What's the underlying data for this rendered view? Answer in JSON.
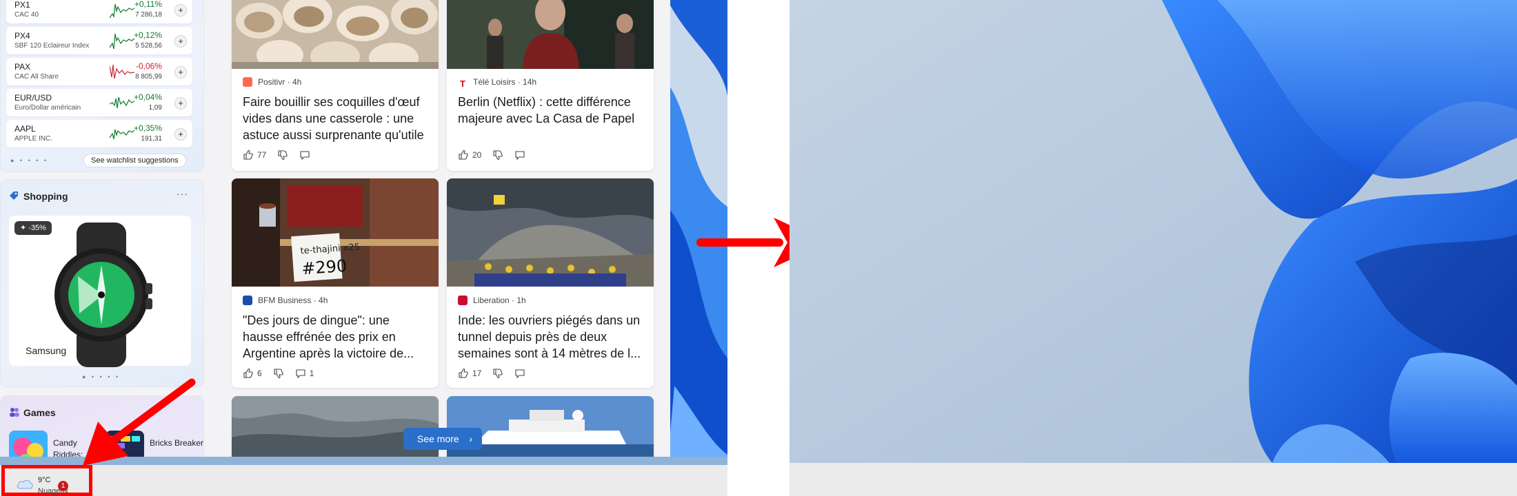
{
  "stocks": [
    {
      "symbol": "PX1",
      "name": "CAC 40",
      "change": "+0,11%",
      "price": "7 286,18",
      "direction": "up"
    },
    {
      "symbol": "PX4",
      "name": "SBF 120 Eclaireur Index",
      "change": "+0,12%",
      "price": "5 528,56",
      "direction": "up"
    },
    {
      "symbol": "PAX",
      "name": "CAC All Share",
      "change": "-0,06%",
      "price": "8 805,99",
      "direction": "down"
    },
    {
      "symbol": "EUR/USD",
      "name": "Euro/Dollar américain",
      "change": "+0,04%",
      "price": "1,09",
      "direction": "up"
    },
    {
      "symbol": "AAPL",
      "name": "APPLE INC.",
      "change": "+0,35%",
      "price": "191,31",
      "direction": "up"
    }
  ],
  "stocks_widget": {
    "dots": "● • • • •",
    "watchlist_label": "See watchlist suggestions"
  },
  "shopping": {
    "title": "Shopping",
    "more": "···",
    "discount": "-35%",
    "brand": "Samsung",
    "dots": "● • • • •"
  },
  "games": {
    "title": "Games",
    "items": [
      {
        "title": "Candy Riddles:"
      },
      {
        "title": "Bricks Breaker"
      }
    ]
  },
  "feed": [
    {
      "source": "Positivr · 4h",
      "headline": "Faire bouillir ses coquilles d'œuf vides dans une casserole : une astuce aussi surprenante qu'utile",
      "likes": "77",
      "comments": ""
    },
    {
      "source": "Télé Loisirs · 14h",
      "headline": "Berlin (Netflix) : cette différence majeure avec La Casa de Papel",
      "likes": "20",
      "comments": ""
    },
    {
      "source": "BFM Business · 4h",
      "headline": "\"Des jours de dingue\": une hausse effrénée des prix en Argentine après la victoire de...",
      "likes": "6",
      "comments": "1"
    },
    {
      "source": "Liberation · 1h",
      "headline": "Inde: les ouvriers piégés dans un tunnel depuis près de deux semaines sont à 14 mètres de l...",
      "likes": "17",
      "comments": ""
    }
  ],
  "price_tag": {
    "small": "te-thajini x25",
    "big": "#290"
  },
  "see_more": {
    "label": "See more",
    "chevron": "›"
  },
  "weather": {
    "temp": "9°C",
    "condition": "Nuageux",
    "badge": "1"
  },
  "colors": {
    "accent": "#2a6fc9",
    "annotation_red": "#ff0000",
    "stock_up": "#0b7a2d",
    "stock_down": "#c4262e"
  }
}
